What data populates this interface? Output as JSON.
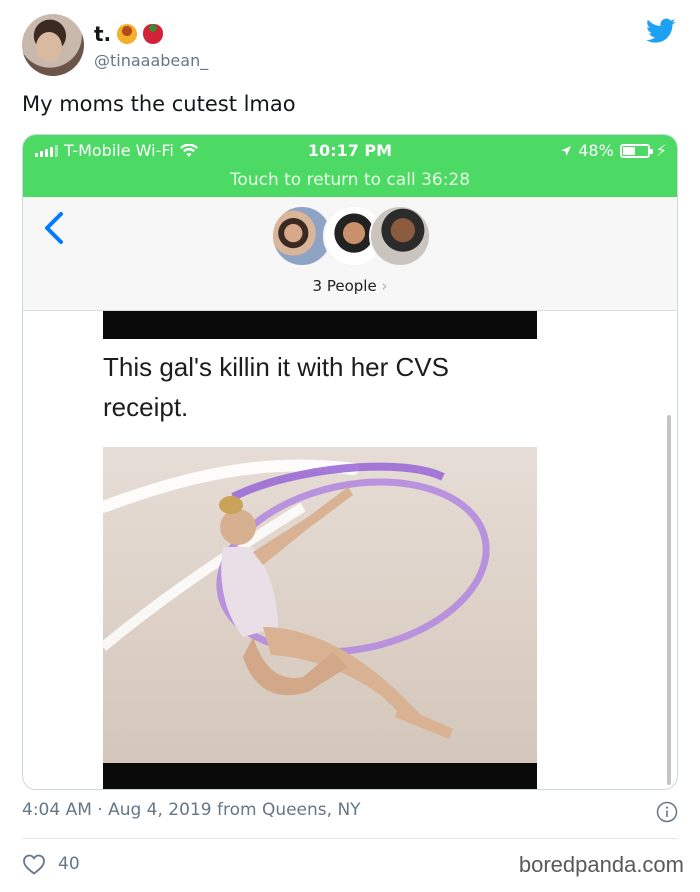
{
  "tweet": {
    "display_name": "t.",
    "handle": "@tinaaabean_",
    "text": "My moms the cutest lmao",
    "timestamp": "4:04 AM · Aug 4, 2019 from Queens, NY",
    "likes": "40",
    "icons": [
      "twitter-bird-icon",
      "info-icon",
      "heart-icon",
      "flan-emoji",
      "strawberry-emoji"
    ],
    "colors": {
      "twitter_blue": "#1da1f2",
      "status_green": "#4cd964",
      "ios_blue": "#007aff",
      "meta_gray": "#657786"
    }
  },
  "screenshot": {
    "status": {
      "carrier": "T-Mobile Wi-Fi",
      "time": "10:17 PM",
      "battery": "48%",
      "call_banner": "Touch to return to call 36:28"
    },
    "conversation": {
      "participants": "3 People"
    },
    "shared_post": {
      "caption": "This gal's killin it with her CVS receipt."
    }
  },
  "watermark": "boredpanda.com"
}
